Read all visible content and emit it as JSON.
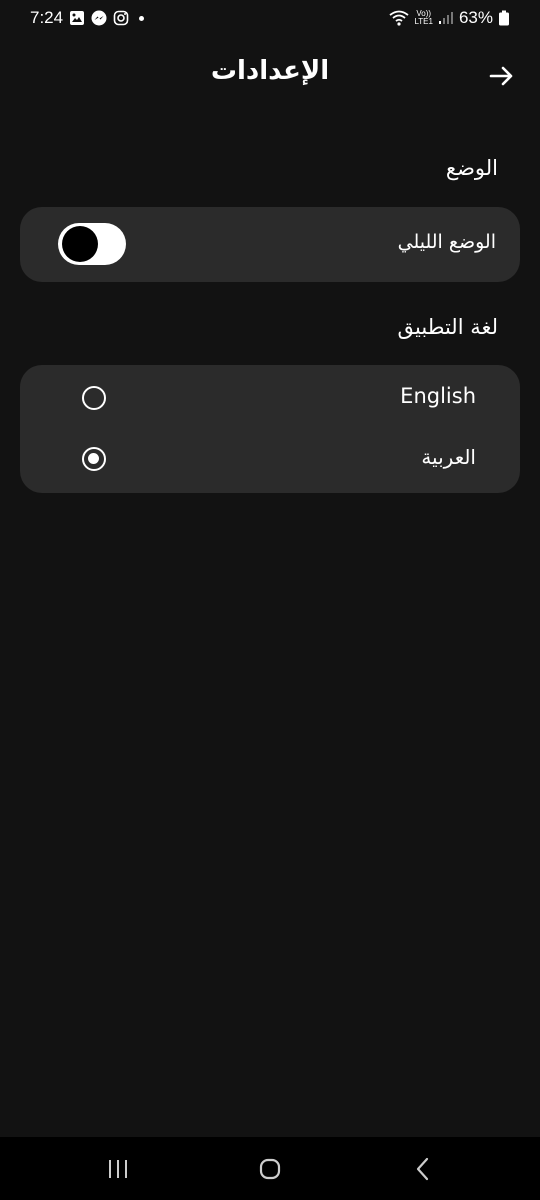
{
  "status_bar": {
    "time": "7:24",
    "battery": "63%",
    "network_top": "Vo))",
    "network_bottom": "LTE1"
  },
  "header": {
    "title": "الإعدادات",
    "back_icon": "arrow-right-icon"
  },
  "mode_section": {
    "label": "الوضع",
    "dark_mode_label": "الوضع الليلي",
    "dark_mode_on": true
  },
  "language_section": {
    "label": "لغة التطبيق",
    "options": [
      {
        "label": "English",
        "selected": false
      },
      {
        "label": "العربية",
        "selected": true
      }
    ]
  },
  "nav_bar": {
    "recents_icon": "recents-icon",
    "home_icon": "home-icon",
    "back_icon": "back-chevron-icon"
  },
  "colors": {
    "background": "#121212",
    "card": "#2b2b2b",
    "text": "#ffffff",
    "nav_bar": "#000000"
  }
}
